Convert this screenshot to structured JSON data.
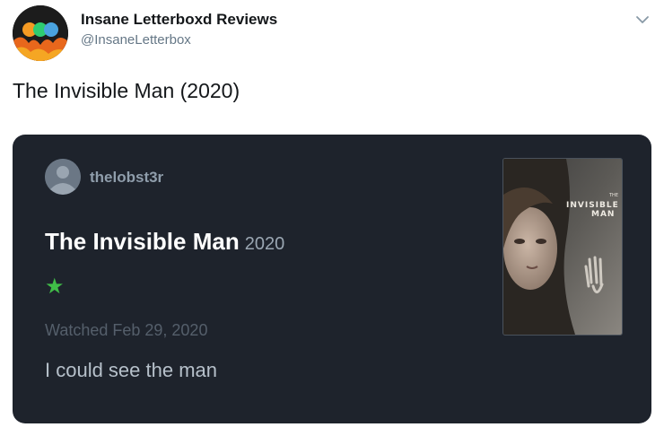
{
  "tweet": {
    "author_name": "Insane Letterboxd Reviews",
    "author_handle": "@InsaneLetterbox",
    "text": "The Invisible Man (2020)"
  },
  "review_card": {
    "reviewer": "thelobst3r",
    "film_title": "The Invisible Man",
    "film_year": "2020",
    "rating": {
      "stars": 1,
      "max": 5,
      "star_color": "#40bd48"
    },
    "watched_label": "Watched Feb 29, 2020",
    "review_text": "I could see the man",
    "poster": {
      "top_word": "THE",
      "title_line1": "INVISIBLE",
      "title_line2": "MAN"
    }
  },
  "colors": {
    "card_background": "#1e232c",
    "handle_grey": "#657786",
    "accent_green": "#40bd48"
  },
  "icons": [
    "account-avatar-icon",
    "chevron-down-icon",
    "default-user-icon",
    "star-icon"
  ]
}
